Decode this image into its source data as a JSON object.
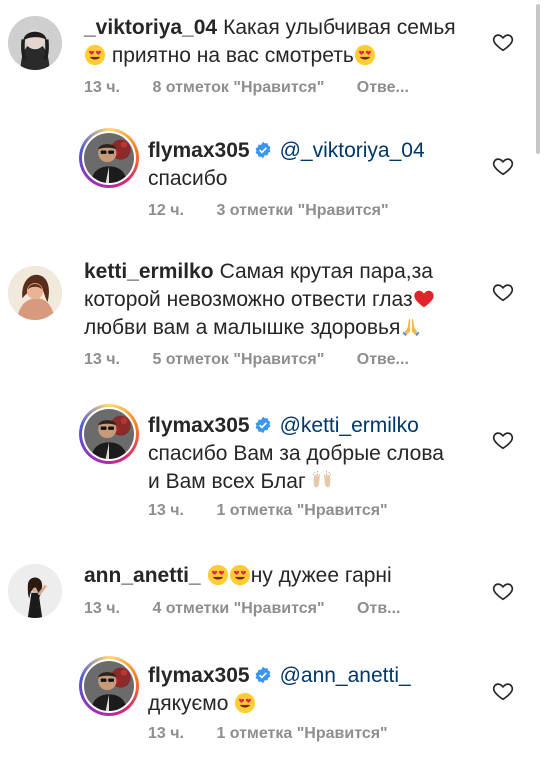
{
  "comments": [
    {
      "username": "_viktoriya_04",
      "text_line1": "Какая улыбчивая семья",
      "text_line2": "приятно на вас смотреть",
      "time": "13 ч.",
      "likes": "8 отметок \"Нравится\"",
      "reply": "Отве..."
    },
    {
      "username": "flymax305",
      "mention": "@_viktoriya_04",
      "text_line1": "спасибо",
      "time": "12 ч.",
      "likes": "3 отметки \"Нравится\""
    },
    {
      "username": "ketti_ermilko",
      "text_line1": "Самая крутая пара,за",
      "text_line2": "которой невозможно отвести глаз",
      "text_line3": "любви вам а малышке здоровья",
      "time": "13 ч.",
      "likes": "5 отметок \"Нравится\"",
      "reply": "Отве..."
    },
    {
      "username": "flymax305",
      "mention": "@ketti_ermilko",
      "text_line1": "спасибо Вам за добрые слова",
      "text_line2": "и Вам всех Благ",
      "time": "13 ч.",
      "likes": "1 отметка \"Нравится\""
    },
    {
      "username": "ann_anetti_",
      "text_line1": "ну дужее гарні",
      "time": "13 ч.",
      "likes": "4 отметки \"Нравится\"",
      "reply": "Отв..."
    },
    {
      "username": "flymax305",
      "mention": "@ann_anetti_",
      "text_line1": "дякуємо",
      "time": "13 ч.",
      "likes": "1 отметка \"Нравится\""
    }
  ],
  "colors": {
    "mention": "#00376b",
    "meta": "#8e8e8e",
    "verified": "#3897f0"
  },
  "icons": {
    "like": "heart-outline-icon",
    "verified": "verified-badge-icon",
    "heart_eyes": "heart-eyes-emoji",
    "red_heart": "red-heart-emoji",
    "praying": "praying-hands-emoji",
    "raising_hands": "raising-hands-emoji"
  }
}
